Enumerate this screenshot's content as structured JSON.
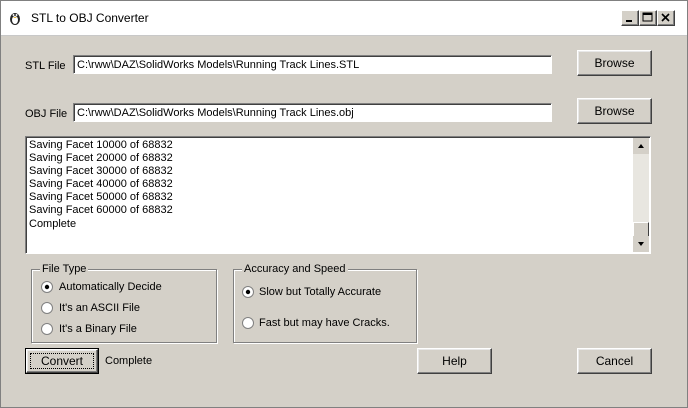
{
  "window": {
    "title": "STL to OBJ Converter",
    "controls": {
      "minimize": "minimize-icon",
      "maximize": "maximize-icon",
      "close": "close-icon"
    }
  },
  "stl": {
    "label": "STL File",
    "value": "C:\\rww\\DAZ\\SolidWorks Models\\Running Track Lines.STL",
    "browse": "Browse"
  },
  "obj": {
    "label": "OBJ File",
    "value": "C:\\rww\\DAZ\\SolidWorks Models\\Running Track Lines.obj",
    "browse": "Browse"
  },
  "log": {
    "lines": [
      "Saving Facet 10000 of 68832",
      "Saving Facet 20000 of 68832",
      "Saving Facet 30000 of 68832",
      "Saving Facet 40000 of 68832",
      "Saving Facet 50000 of 68832",
      "Saving Facet 60000 of 68832",
      "Complete"
    ]
  },
  "file_type": {
    "title": "File Type",
    "options": [
      "Automatically Decide",
      "It's an ASCII File",
      "It's a Binary File"
    ],
    "selected": "Automatically Decide"
  },
  "accuracy": {
    "title": "Accuracy and Speed",
    "options": [
      "Slow but Totally Accurate",
      "Fast but may have Cracks."
    ],
    "selected": "Slow but Totally Accurate"
  },
  "actions": {
    "convert": "Convert",
    "status": "Complete",
    "help": "Help",
    "cancel": "Cancel"
  }
}
